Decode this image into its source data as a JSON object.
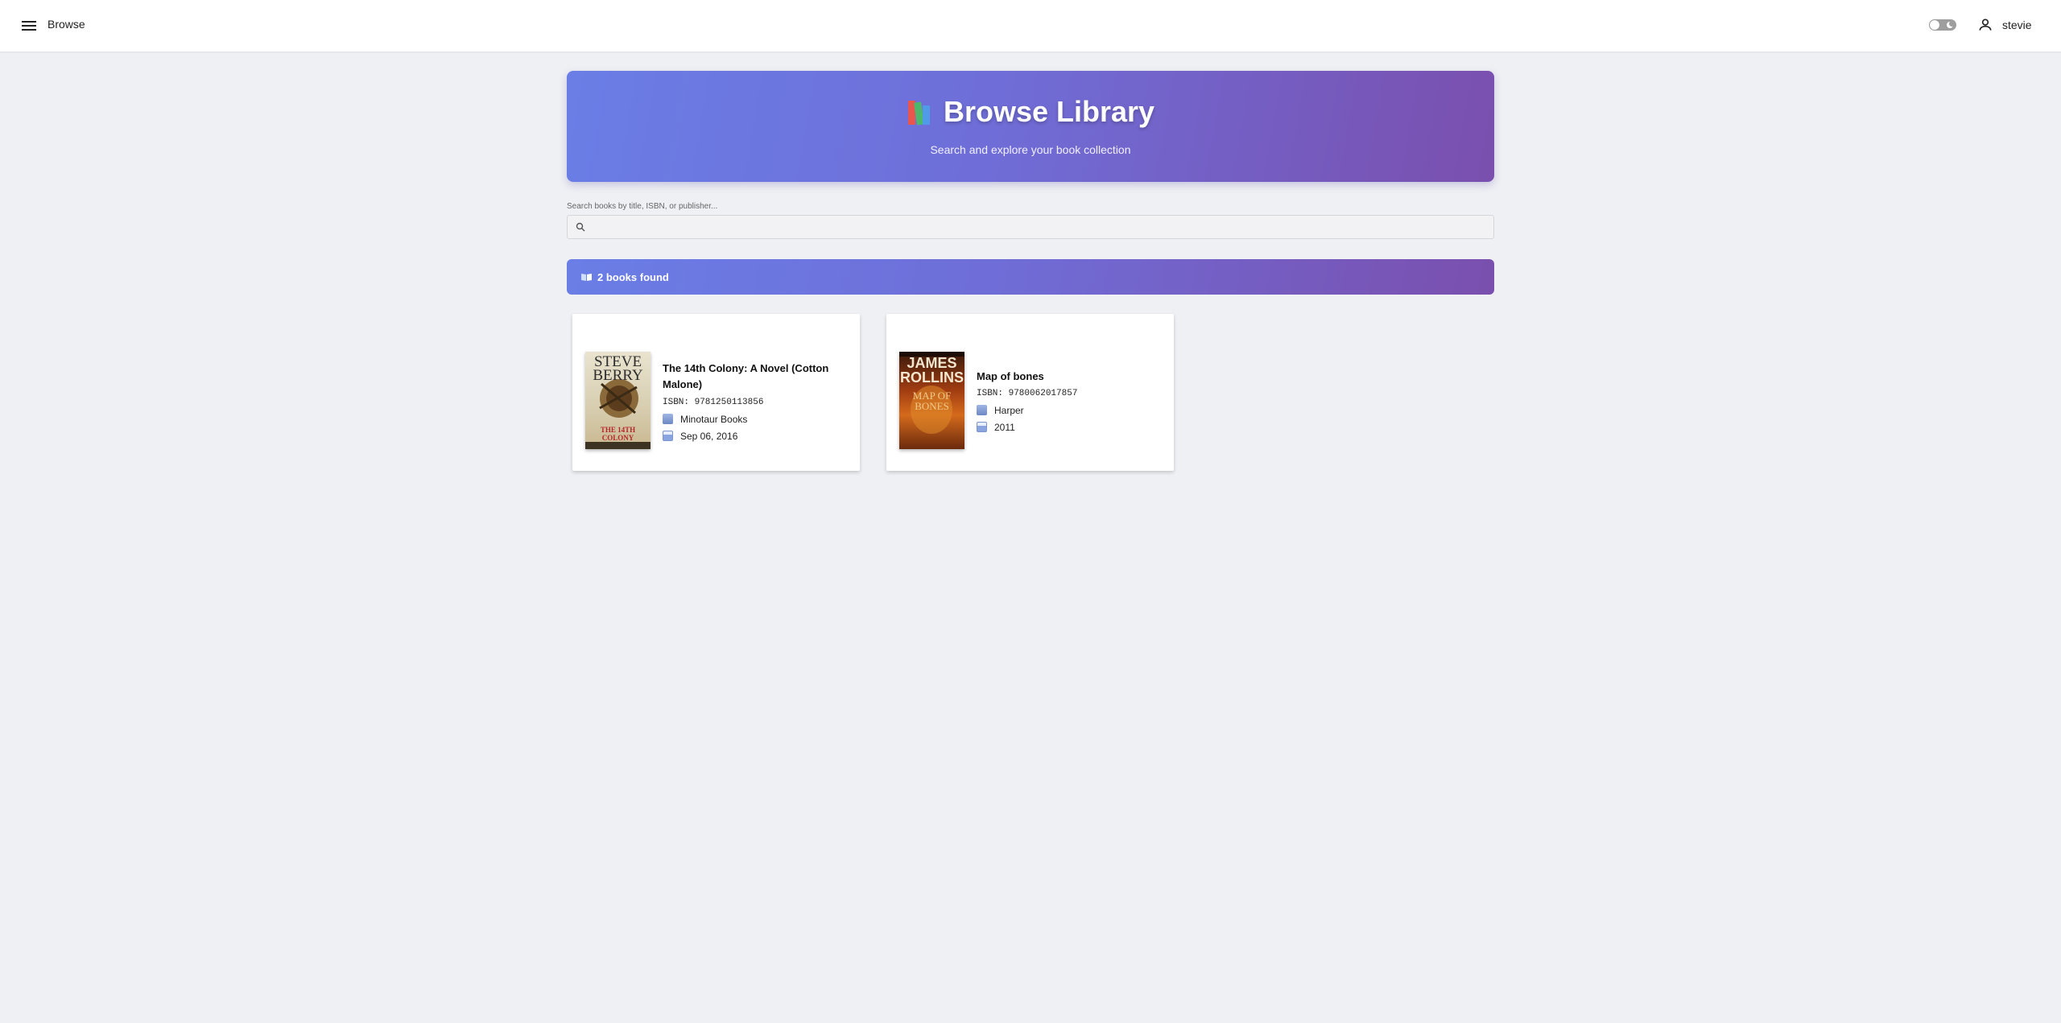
{
  "topbar": {
    "page_name": "Browse",
    "username": "stevie"
  },
  "hero": {
    "title": "Browse Library",
    "subtitle": "Search and explore your book collection",
    "icon": "books-emoji"
  },
  "search": {
    "label": "Search books by title, ISBN, or publisher...",
    "value": ""
  },
  "results": {
    "count_text": "2 books found"
  },
  "books": [
    {
      "title": "The 14th Colony: A Novel (Cotton Malone)",
      "isbn": "ISBN: 9781250113856",
      "publisher": "Minotaur Books",
      "date": "Sep 06, 2016",
      "cover_author": "STEVE BERRY",
      "cover_title": "THE 14TH COLONY"
    },
    {
      "title": "Map of bones",
      "isbn": "ISBN: 9780062017857",
      "publisher": "Harper",
      "date": "2011",
      "cover_author": "JAMES ROLLINS",
      "cover_title": "MAP OF BONES"
    }
  ],
  "colors": {
    "accent_start": "#6a7ee6",
    "accent_end": "#7a4fae",
    "background": "#eff0f4"
  }
}
